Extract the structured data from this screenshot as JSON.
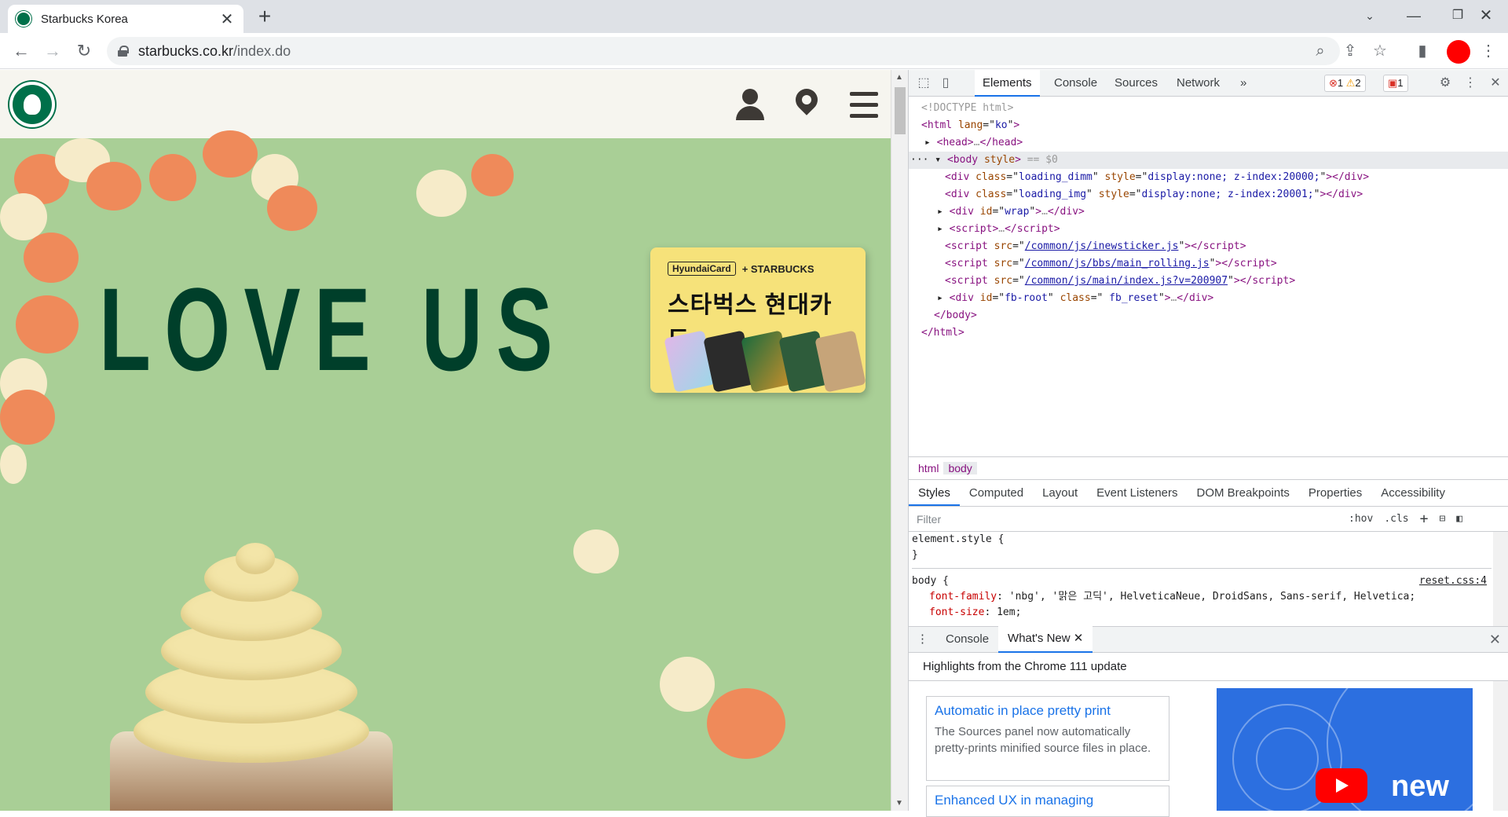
{
  "browser": {
    "tab_title": "Starbucks Korea",
    "url_host": "starbucks.co.kr",
    "url_path": "/index.do"
  },
  "page": {
    "hero_text": "LOVE US",
    "card": {
      "brand_left": "HyundaiCard",
      "brand_right": "+ STARBUCKS",
      "title": "스타벅스 현대카드"
    }
  },
  "devtools": {
    "tabs": [
      "Elements",
      "Console",
      "Sources",
      "Network"
    ],
    "more": "»",
    "badges": {
      "errors": "1",
      "warnings": "2",
      "issues": "1"
    },
    "dom": {
      "doctype": "<!DOCTYPE html>",
      "html_open_tag": "html",
      "html_lang_attr": "lang",
      "html_lang_val": "ko",
      "head": "head",
      "body_tag": "body",
      "body_attr": "style",
      "selected_marker": "== $0",
      "div1_class": "loading_dimm",
      "div1_style": "display:none; z-index:20000;",
      "div2_class": "loading_img",
      "div2_style": "display:none; z-index:20001;",
      "wrap_id": "wrap",
      "script1_src": "/common/js/inewsticker.js",
      "script2_src": "/common/js/bbs/main_rolling.js",
      "script3_src": "/common/js/main/index.js?v=200907",
      "fbroot_id": "fb-root",
      "fbroot_class": " fb_reset"
    },
    "breadcrumbs": [
      "html",
      "body"
    ],
    "style_tabs": [
      "Styles",
      "Computed",
      "Layout",
      "Event Listeners",
      "DOM Breakpoints",
      "Properties",
      "Accessibility"
    ],
    "filter_placeholder": "Filter",
    "hov": ":hov",
    "cls": ".cls",
    "rules": {
      "element_style": "element.style {",
      "close": "}",
      "body_selector": "body {",
      "body_source": "reset.css:4",
      "prop1_name": "font-family",
      "prop1_value": "'nbg', '맑은 고딕', HelveticaNeue, DroidSans, Sans-serif, Helvetica;",
      "prop2_name": "font-size",
      "prop2_value": "1em;"
    },
    "drawer_tabs": [
      "Console",
      "What's New"
    ],
    "highlights": "Highlights from the Chrome 111 update",
    "whatsnew": [
      {
        "title": "Automatic in place pretty print",
        "desc": "The Sources panel now automatically pretty-prints minified source files in place."
      },
      {
        "title": "Enhanced UX in managing",
        "desc": ""
      }
    ],
    "video_label": "new"
  },
  "colors": {
    "starbucks_green": "#00704a",
    "hero_bg": "#a9cf96",
    "hero_text": "#003f2a",
    "accent": "#1a73e8"
  }
}
